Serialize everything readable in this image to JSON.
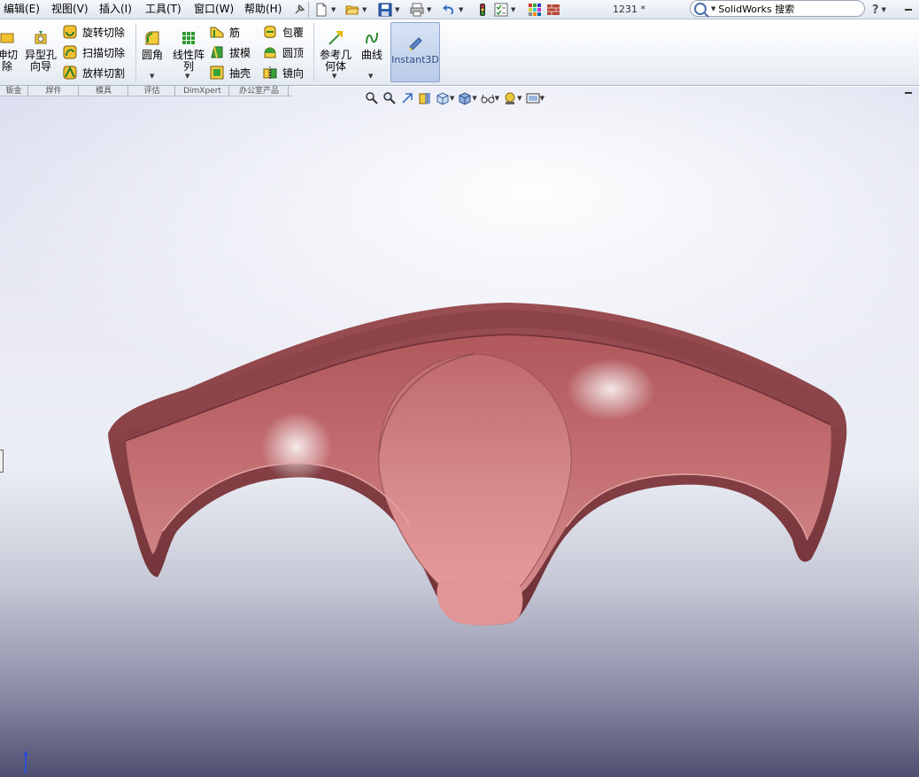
{
  "menubar": {
    "items": [
      {
        "label": "编辑(E)"
      },
      {
        "label": "视图(V)"
      },
      {
        "label": "插入(I)"
      },
      {
        "label": "工具(T)"
      },
      {
        "label": "窗口(W)"
      },
      {
        "label": "帮助(H)"
      }
    ],
    "doc_title": "1231 *",
    "search_placeholder": "SolidWorks 搜索",
    "help_label": "?"
  },
  "ribbon": {
    "extrude_cut_label": "伸切",
    "extrude_cut_label2": "除",
    "hole_wizard_label": "异型孔",
    "hole_wizard_label2": "向导",
    "revolve_cut_label": "旋转切除",
    "sweep_cut_label": "扫描切除",
    "loft_cut_label": "放样切割",
    "fillet_label": "圆角",
    "linear_pattern_label": "线性阵",
    "linear_pattern_label2": "列",
    "rib_label": "筋",
    "draft_label": "拔模",
    "shell_label": "抽壳",
    "wrap_label": "包覆",
    "dome_label": "圆顶",
    "mirror_label": "镜向",
    "ref_geom_label": "参考几",
    "ref_geom_label2": "何体",
    "curves_label": "曲线",
    "instant3d_label": "Instant3D"
  },
  "tabs": [
    {
      "label": "钣金"
    },
    {
      "label": "焊件"
    },
    {
      "label": "模具"
    },
    {
      "label": "评估"
    },
    {
      "label": "DimXpert"
    },
    {
      "label": "办公室产品"
    }
  ],
  "model": {
    "color": "#b86a6c",
    "dark": "#7a3c40",
    "light": "#e8a8a8"
  }
}
